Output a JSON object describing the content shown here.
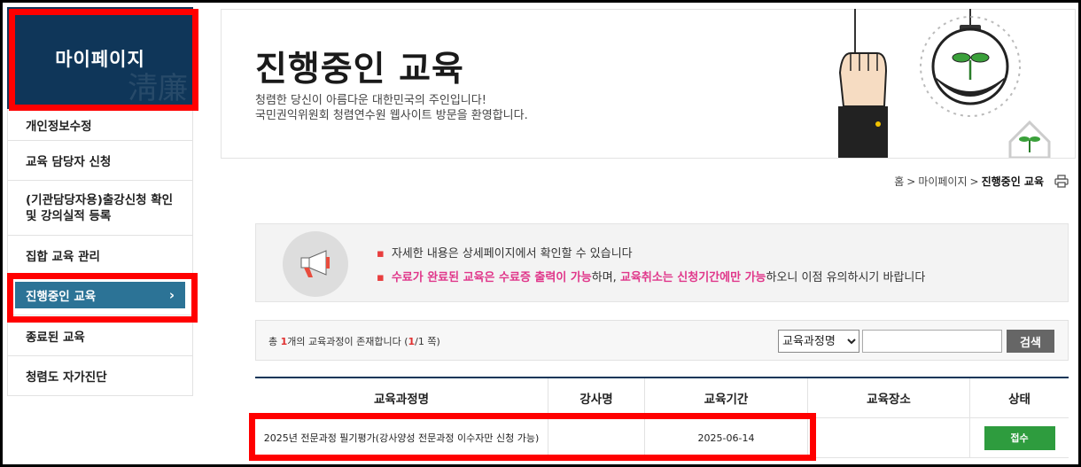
{
  "sidebar": {
    "title": "마이페이지",
    "watermark": "淸廉",
    "items": [
      {
        "label": "개인정보수정"
      },
      {
        "label": "교육 담당자 신청"
      },
      {
        "label": "(기관담당자용)출강신청 확인 및 강의실적 등록"
      },
      {
        "label": "집합 교육 관리"
      },
      {
        "label": "진행중인 교육",
        "active": true,
        "chevron": "›"
      },
      {
        "label": "종료된 교육"
      },
      {
        "label": "청렴도 자가진단"
      }
    ]
  },
  "header": {
    "title": "진행중인 교육",
    "subtitle_line1": "청렴한 당신이 아름다운 대한민국의 주인입니다!",
    "subtitle_line2": "국민권익위원회 청렴연수원 웹사이트 방문을 환영합니다."
  },
  "breadcrumb": {
    "home": "홈",
    "sep": ">",
    "parent": "마이페이지",
    "current": "진행중인 교육",
    "print_icon": "printer-icon"
  },
  "notice": {
    "icon": "megaphone-icon",
    "bullet": "▪",
    "line1": "자세한 내용은 상세페이지에서 확인할 수 있습니다",
    "line2_pink1": "수료가 완료된 교육은 수료증 출력이 가능",
    "line2_mid": "하며, ",
    "line2_pink2": "교육취소는 신청기간에만 가능",
    "line2_end": "하오니 이점 유의하시기 바랍니다"
  },
  "search": {
    "count_prefix": "총 ",
    "count": "1",
    "count_mid": "개의 교육과정이 존재합니다 (",
    "page_current": "1",
    "page_total": "/1 쪽)",
    "select_value": "교육과정명",
    "input_value": "",
    "button": "검색"
  },
  "table": {
    "headers": [
      "교육과정명",
      "강사명",
      "교육기간",
      "교육장소",
      "상태"
    ],
    "rows": [
      {
        "course": "2025년 전문과정 필기평가(강사양성 전문과정 이수자만 신청 가능)",
        "instructor": "",
        "period": "2025-06-14",
        "place": "",
        "status": "접수"
      }
    ]
  },
  "colors": {
    "navy": "#0f3659",
    "active": "#2c7396",
    "pink": "#e0368a",
    "green": "#2e9c3e",
    "highlight": "#ff0000"
  }
}
